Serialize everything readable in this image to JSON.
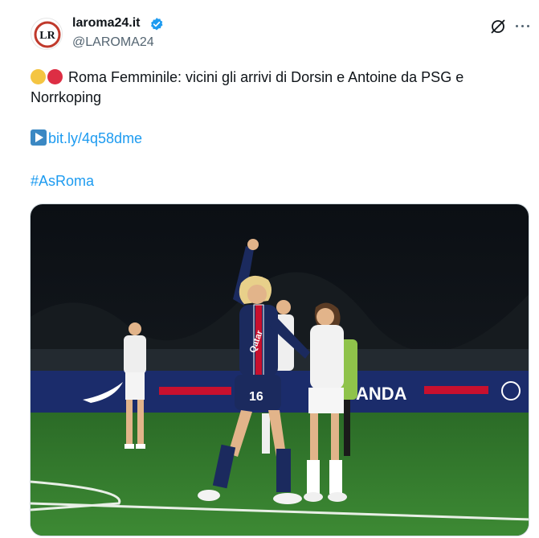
{
  "account": {
    "name": "laroma24.it",
    "handle": "@LAROMA24",
    "avatar_text": "LR",
    "verified_icon": "verified-badge-icon"
  },
  "tweet": {
    "text": "Roma Femminile: vicini gli arrivi di Dorsin e Antoine da PSG e Norrkoping",
    "emoji_colors": [
      "#f4c542",
      "#dd2e44"
    ],
    "link": "bit.ly/4q58dme",
    "hashtag": "#AsRoma"
  },
  "media": {
    "board_text": "ANDA",
    "player_number": "16",
    "shirt_text": "Qatar"
  },
  "colors": {
    "link": "#1d9bf0",
    "pitch": "#2f7a2a",
    "psg_navy": "#1b2a5e"
  }
}
